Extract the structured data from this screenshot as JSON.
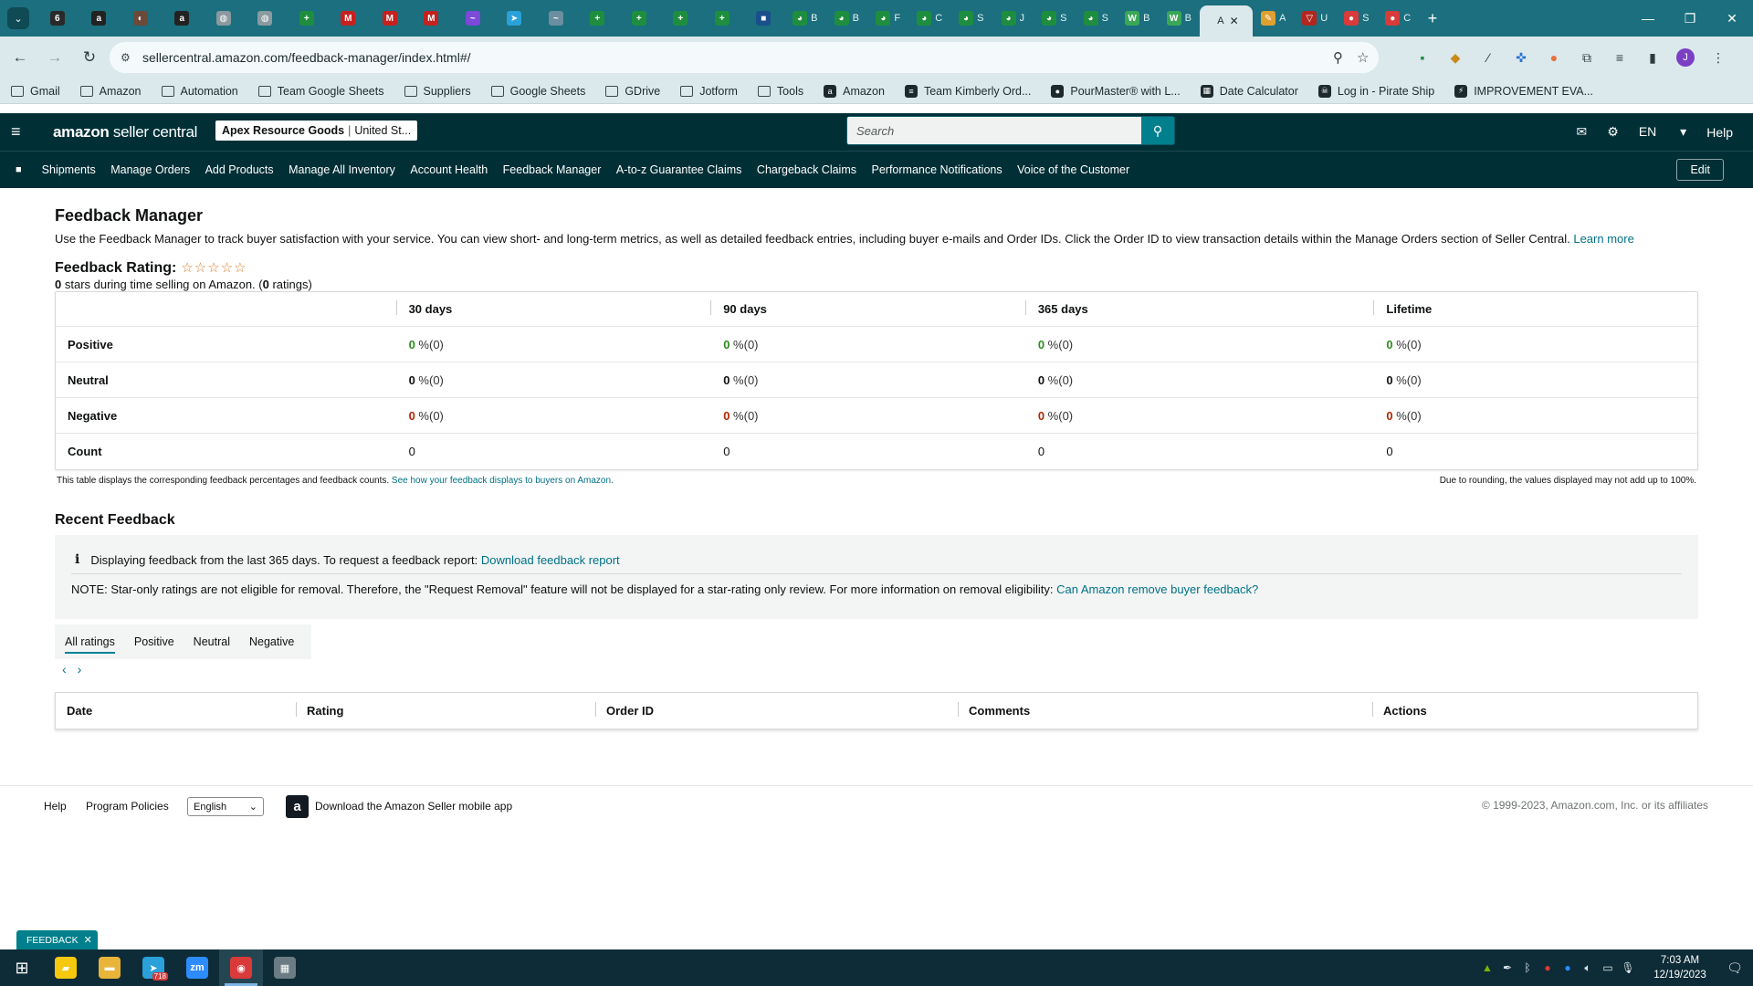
{
  "browser": {
    "tabs": [
      {
        "title": "",
        "favicon": "6",
        "color": "#2a2a2a"
      },
      {
        "title": "",
        "favicon": "a",
        "color": "#222222"
      },
      {
        "title": "",
        "favicon": "◐",
        "color": "#6b4a3a"
      },
      {
        "title": "",
        "favicon": "a",
        "color": "#222222"
      },
      {
        "title": "",
        "favicon": "◍",
        "color": "#8a9aa0"
      },
      {
        "title": "",
        "favicon": "◍",
        "color": "#8a9aa0"
      },
      {
        "title": "",
        "favicon": "+",
        "color": "#1e8e3e"
      },
      {
        "title": "",
        "favicon": "M",
        "color": "#c5221f"
      },
      {
        "title": "",
        "favicon": "M",
        "color": "#c5221f"
      },
      {
        "title": "",
        "favicon": "M",
        "color": "#c5221f"
      },
      {
        "title": "",
        "favicon": "~",
        "color": "#7b4ad9"
      },
      {
        "title": "",
        "favicon": "➤",
        "color": "#2aa1d9"
      },
      {
        "title": "",
        "favicon": "~",
        "color": "#6b8fa0"
      },
      {
        "title": "",
        "favicon": "+",
        "color": "#1e8e3e"
      },
      {
        "title": "",
        "favicon": "+",
        "color": "#1e8e3e"
      },
      {
        "title": "",
        "favicon": "+",
        "color": "#1e8e3e"
      },
      {
        "title": "",
        "favicon": "+",
        "color": "#1e8e3e"
      },
      {
        "title": "",
        "favicon": "■",
        "color": "#1a4f8a"
      },
      {
        "title": "B",
        "favicon": "◕",
        "color": "#1e8e3e"
      },
      {
        "title": "B",
        "favicon": "◕",
        "color": "#1e8e3e"
      },
      {
        "title": "F",
        "favicon": "◕",
        "color": "#1e8e3e"
      },
      {
        "title": "C",
        "favicon": "◕",
        "color": "#1e8e3e"
      },
      {
        "title": "S",
        "favicon": "◕",
        "color": "#1e8e3e"
      },
      {
        "title": "J",
        "favicon": "◕",
        "color": "#1e8e3e"
      },
      {
        "title": "S",
        "favicon": "◕",
        "color": "#1e8e3e"
      },
      {
        "title": "S",
        "favicon": "◕",
        "color": "#1e8e3e"
      },
      {
        "title": "B",
        "favicon": "W",
        "color": "#3aa757"
      },
      {
        "title": "B",
        "favicon": "W",
        "color": "#3aa757"
      },
      {
        "title": "A",
        "favicon": "",
        "color": "#dbe9ec",
        "active": true
      },
      {
        "title": "A",
        "favicon": "✎",
        "color": "#e0a030"
      },
      {
        "title": "U",
        "favicon": "▽",
        "color": "#b3261e"
      },
      {
        "title": "S",
        "favicon": "●",
        "color": "#d93a3a"
      },
      {
        "title": "C",
        "favicon": "●",
        "color": "#d93a3a"
      }
    ],
    "url": "sellercentral.amazon.com/feedback-manager/index.html#/",
    "bookmarks": [
      {
        "label": "Gmail",
        "type": "folder"
      },
      {
        "label": "Amazon",
        "type": "folder"
      },
      {
        "label": "Automation",
        "type": "folder"
      },
      {
        "label": "Team Google Sheets",
        "type": "folder"
      },
      {
        "label": "Suppliers",
        "type": "folder"
      },
      {
        "label": "Google Sheets",
        "type": "folder"
      },
      {
        "label": "GDrive",
        "type": "folder"
      },
      {
        "label": "Jotform",
        "type": "folder"
      },
      {
        "label": "Tools",
        "type": "folder"
      },
      {
        "label": "Amazon",
        "type": "site",
        "icon": "a"
      },
      {
        "label": "Team Kimberly Ord...",
        "type": "site",
        "icon": "≡"
      },
      {
        "label": "PourMaster® with L...",
        "type": "site",
        "icon": "●"
      },
      {
        "label": "Date Calculator",
        "type": "site",
        "icon": "▦"
      },
      {
        "label": "Log in - Pirate Ship",
        "type": "site",
        "icon": "☠"
      },
      {
        "label": "IMPROVEMENT EVA...",
        "type": "site",
        "icon": "⚡"
      }
    ],
    "profile_initial": "J"
  },
  "header": {
    "logo_main": "amazon",
    "logo_sub": " seller central",
    "store_name": "Apex Resource Goods",
    "store_market": "United St...",
    "search_placeholder": "Search",
    "language": "EN",
    "help": "Help"
  },
  "nav": {
    "items": [
      "Shipments",
      "Manage Orders",
      "Add Products",
      "Manage All Inventory",
      "Account Health",
      "Feedback Manager",
      "A-to-z Guarantee Claims",
      "Chargeback Claims",
      "Performance Notifications",
      "Voice of the Customer"
    ],
    "edit": "Edit"
  },
  "page": {
    "title": "Feedback Manager",
    "description": "Use the Feedback Manager to track buyer satisfaction with your service. You can view short- and long-term metrics, as well as detailed feedback entries, including buyer e-mails and Order IDs. Click the Order ID to view transaction details within the Manage Orders section of Seller Central.",
    "learn_more": "Learn more",
    "rating_label": "Feedback Rating:",
    "stars": "☆☆☆☆☆",
    "rating_value": "0",
    "rating_mid": " stars during time selling on Amazon. (",
    "rating_count": "0",
    "rating_end": " ratings)"
  },
  "feedback_table": {
    "columns": [
      "",
      "30 days",
      "90 days",
      "365 days",
      "Lifetime"
    ],
    "rows": [
      {
        "label": "Positive",
        "kind": "green",
        "cells": [
          {
            "num": "0",
            "pct": " %(0)"
          },
          {
            "num": "0",
            "pct": " %(0)"
          },
          {
            "num": "0",
            "pct": " %(0)"
          },
          {
            "num": "0",
            "pct": " %(0)"
          }
        ]
      },
      {
        "label": "Neutral",
        "kind": "plain",
        "cells": [
          {
            "num": "0",
            "pct": " %(0)"
          },
          {
            "num": "0",
            "pct": " %(0)"
          },
          {
            "num": "0",
            "pct": " %(0)"
          },
          {
            "num": "0",
            "pct": " %(0)"
          }
        ]
      },
      {
        "label": "Negative",
        "kind": "red",
        "cells": [
          {
            "num": "0",
            "pct": " %(0)"
          },
          {
            "num": "0",
            "pct": " %(0)"
          },
          {
            "num": "0",
            "pct": " %(0)"
          },
          {
            "num": "0",
            "pct": " %(0)"
          }
        ]
      },
      {
        "label": "Count",
        "kind": "count",
        "cells": [
          {
            "num": "0",
            "pct": ""
          },
          {
            "num": "0",
            "pct": ""
          },
          {
            "num": "0",
            "pct": ""
          },
          {
            "num": "0",
            "pct": ""
          }
        ]
      }
    ],
    "note": "This table displays the corresponding feedback percentages and feedback counts.",
    "note_link": "See how your feedback displays to buyers on Amazon.",
    "rounding_note": "Due to rounding, the values displayed may not add up to 100%."
  },
  "recent": {
    "title": "Recent Feedback",
    "info_text": "Displaying feedback from the last 365 days. To request a feedback report:",
    "info_link": "Download feedback report",
    "note_text": "NOTE: Star-only ratings are not eligible for removal. Therefore, the \"Request Removal\" feature will not be displayed for a star-rating only review. For more information on removal eligibility:",
    "note_link": "Can Amazon remove buyer feedback?",
    "tabs": [
      "All ratings",
      "Positive",
      "Neutral",
      "Negative"
    ],
    "columns": [
      "Date",
      "Rating",
      "Order ID",
      "Comments",
      "Actions"
    ]
  },
  "footer": {
    "help": "Help",
    "policies": "Program Policies",
    "language": "English",
    "app_text": "Download the Amazon Seller mobile app",
    "copyright": "© 1999-2023, Amazon.com, Inc. or its affiliates"
  },
  "feedback_button": "FEEDBACK",
  "taskbar": {
    "apps": [
      {
        "name": "sticky-notes",
        "glyph": "▰",
        "color": "#f6c90e"
      },
      {
        "name": "file-explorer",
        "glyph": "▬",
        "color": "#e8b53a"
      },
      {
        "name": "telegram",
        "glyph": "➤",
        "color": "#2aa1d9",
        "badge": "718"
      },
      {
        "name": "zoom",
        "glyph": "zm",
        "color": "#2d8cff"
      },
      {
        "name": "chrome",
        "glyph": "◉",
        "color": "#d93a3a",
        "active": true
      },
      {
        "name": "calculator",
        "glyph": "▦",
        "color": "#6b7c85"
      }
    ],
    "time": "7:03 AM",
    "date": "12/19/2023"
  },
  "colors": {
    "teal_header": "#002f36",
    "link": "#007185",
    "positive": "#2f8a1f",
    "negative": "#b12704",
    "chrome": "#1b6f7e"
  }
}
